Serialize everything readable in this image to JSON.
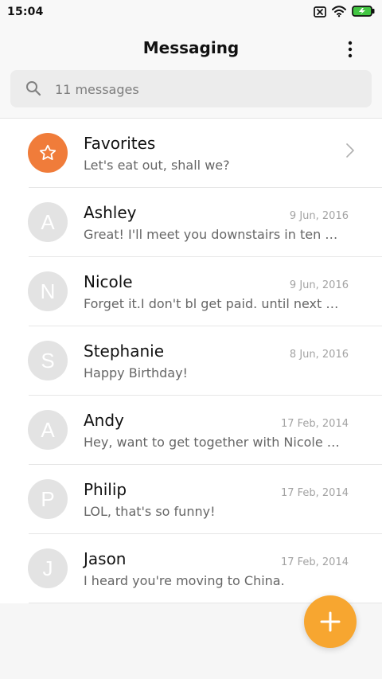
{
  "status_bar": {
    "time": "15:04",
    "icons": [
      "close-box-icon",
      "wifi-icon",
      "battery-charging-icon"
    ]
  },
  "header": {
    "title": "Messaging",
    "menu_icon": "more-vertical-icon"
  },
  "search": {
    "placeholder": "11 messages",
    "icon": "search-icon"
  },
  "favorites": {
    "label": "Favorites",
    "preview": "Let's eat out, shall we?",
    "icon": "star-icon",
    "chevron_icon": "chevron-right-icon"
  },
  "conversations": [
    {
      "initial": "A",
      "name": "Ashley",
      "preview": "Great! I'll meet you downstairs in ten …",
      "date": "9 Jun, 2016"
    },
    {
      "initial": "N",
      "name": "Nicole",
      "preview": "Forget it.I don't bl get paid. until next …",
      "date": "9 Jun, 2016"
    },
    {
      "initial": "S",
      "name": "Stephanie",
      "preview": "Happy Birthday!",
      "date": "8 Jun, 2016"
    },
    {
      "initial": "A",
      "name": "Andy",
      "preview": "Hey, want to get together with Nicole …",
      "date": "17 Feb, 2014"
    },
    {
      "initial": "P",
      "name": "Philip",
      "preview": "LOL, that's so funny!",
      "date": "17 Feb, 2014"
    },
    {
      "initial": "J",
      "name": "Jason",
      "preview": "I heard you're moving to China.",
      "date": "17 Feb, 2014"
    }
  ],
  "fab": {
    "icon": "plus-icon"
  },
  "colors": {
    "favorite_accent": "#f07c3a",
    "fab": "#f7a630",
    "avatar_bg": "#e3e3e3",
    "battery": "#43c643"
  }
}
